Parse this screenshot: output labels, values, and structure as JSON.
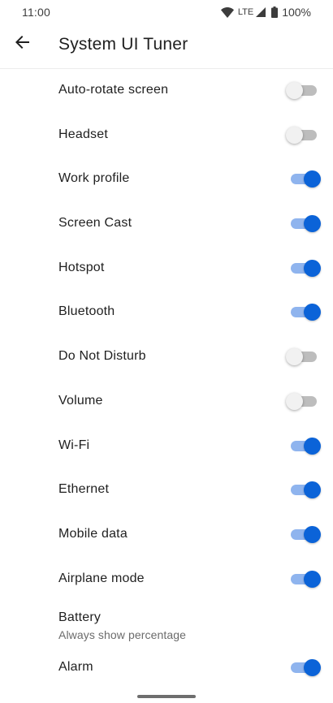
{
  "status": {
    "time": "11:00",
    "network": "LTE",
    "battery": "100%"
  },
  "header": {
    "title": "System UI Tuner"
  },
  "items": [
    {
      "label": "Auto-rotate screen",
      "on": false
    },
    {
      "label": "Headset",
      "on": false
    },
    {
      "label": "Work profile",
      "on": true
    },
    {
      "label": "Screen Cast",
      "on": true
    },
    {
      "label": "Hotspot",
      "on": true
    },
    {
      "label": "Bluetooth",
      "on": true
    },
    {
      "label": "Do Not Disturb",
      "on": false
    },
    {
      "label": "Volume",
      "on": false
    },
    {
      "label": "Wi-Fi",
      "on": true
    },
    {
      "label": "Ethernet",
      "on": true
    },
    {
      "label": "Mobile data",
      "on": true
    },
    {
      "label": "Airplane mode",
      "on": true
    },
    {
      "label": "Battery",
      "sublabel": "Always show percentage"
    },
    {
      "label": "Alarm",
      "on": true
    }
  ],
  "colors": {
    "accent": "#0b63d8",
    "track_on": "#8fb4ee",
    "track_off": "#bdbdbd"
  }
}
